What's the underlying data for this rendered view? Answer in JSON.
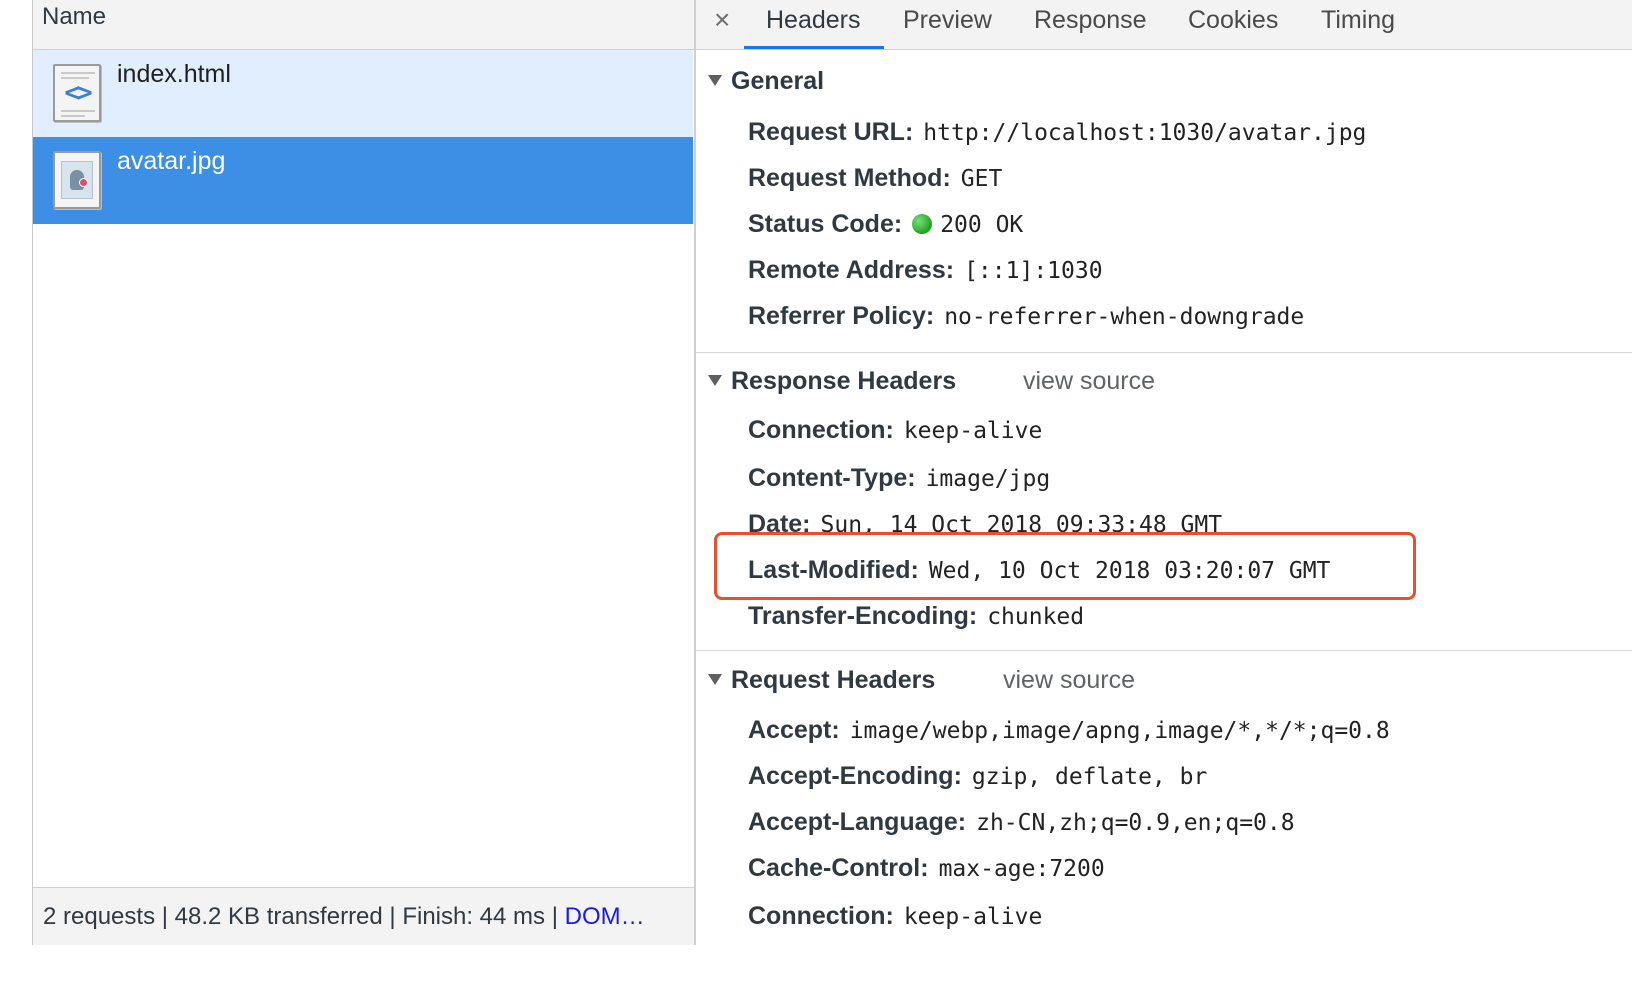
{
  "network_list": {
    "column_header": "Name",
    "requests": [
      {
        "name": "index.html",
        "icon": "html-file-icon"
      },
      {
        "name": "avatar.jpg",
        "icon": "image-file-icon"
      }
    ],
    "selected_color": "#3d8fe6",
    "status_bar": {
      "summary": "2 requests | 48.2 KB transferred | Finish: 44 ms | ",
      "link": "DOM…"
    }
  },
  "details": {
    "close_label": "×",
    "tabs": [
      "Headers",
      "Preview",
      "Response",
      "Cookies",
      "Timing"
    ],
    "active_tab": "Headers",
    "general": {
      "title": "General",
      "rows": [
        {
          "key": "Request URL:",
          "value": "http://localhost:1030/avatar.jpg"
        },
        {
          "key": "Request Method:",
          "value": "GET"
        },
        {
          "key": "Status Code:",
          "value": "200 OK",
          "status_color": "#20a020"
        },
        {
          "key": "Remote Address:",
          "value": "[::1]:1030"
        },
        {
          "key": "Referrer Policy:",
          "value": "no-referrer-when-downgrade"
        }
      ]
    },
    "response_headers": {
      "title": "Response Headers",
      "view_source": "view source",
      "rows": [
        {
          "key": "Connection:",
          "value": "keep-alive"
        },
        {
          "key": "Content-Type:",
          "value": "image/jpg"
        },
        {
          "key": "Date:",
          "value": "Sun, 14 Oct 2018 09:33:48 GMT"
        },
        {
          "key": "Last-Modified:",
          "value": "Wed, 10 Oct 2018 03:20:07 GMT"
        },
        {
          "key": "Transfer-Encoding:",
          "value": "chunked"
        }
      ],
      "highlight_color": "#e2522c"
    },
    "request_headers": {
      "title": "Request Headers",
      "view_source": "view source",
      "rows": [
        {
          "key": "Accept:",
          "value": "image/webp,image/apng,image/*,*/*;q=0.8"
        },
        {
          "key": "Accept-Encoding:",
          "value": "gzip, deflate, br"
        },
        {
          "key": "Accept-Language:",
          "value": "zh-CN,zh;q=0.9,en;q=0.8"
        },
        {
          "key": "Cache-Control:",
          "value": "max-age:7200"
        },
        {
          "key": "Connection:",
          "value": "keep-alive"
        }
      ]
    }
  }
}
